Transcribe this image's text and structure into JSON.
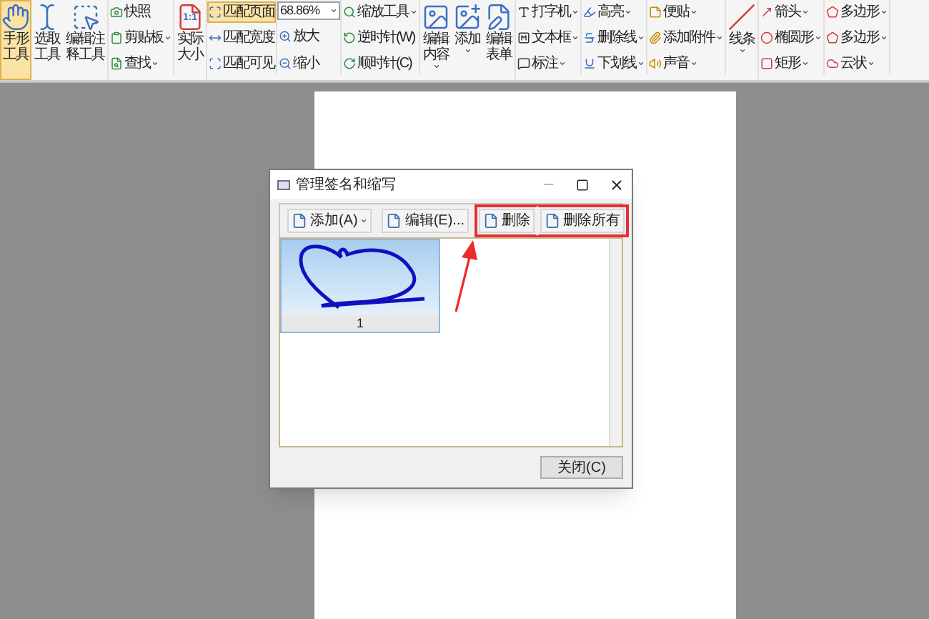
{
  "toolbar": {
    "sections": [
      {
        "kind": "big",
        "items": [
          {
            "label": "手形工具",
            "selected": true,
            "dropdown": false
          },
          {
            "label": "选取工具",
            "selected": false,
            "dropdown": false
          },
          {
            "label": "编辑注释工具",
            "selected": false,
            "dropdown": false
          }
        ]
      },
      {
        "kind": "stack",
        "items": [
          {
            "label": "快照",
            "selected": false,
            "dropdown": false
          },
          {
            "label": "剪贴板",
            "selected": false,
            "dropdown": true
          },
          {
            "label": "查找",
            "selected": false,
            "dropdown": true
          }
        ]
      },
      {
        "kind": "big",
        "items": [
          {
            "label": "实际大小",
            "badge": "1:1",
            "selected": false,
            "dropdown": false
          }
        ]
      },
      {
        "kind": "stack",
        "items": [
          {
            "label": "匹配页面",
            "selected": true,
            "dropdown": false
          },
          {
            "label": "匹配宽度",
            "selected": false,
            "dropdown": false
          },
          {
            "label": "匹配可见",
            "selected": false,
            "dropdown": false
          }
        ]
      },
      {
        "kind": "zoom",
        "items": [
          {
            "label": "68.86%",
            "dropdown": true
          },
          {
            "label": "放大",
            "selected": false,
            "dropdown": false
          },
          {
            "label": "缩小",
            "selected": false,
            "dropdown": false
          }
        ]
      },
      {
        "kind": "stack",
        "items": [
          {
            "label": "缩放工具",
            "selected": false,
            "dropdown": true
          },
          {
            "label": "逆时针(W)",
            "selected": false,
            "dropdown": false
          },
          {
            "label": "顺时针(C)",
            "selected": false,
            "dropdown": false
          }
        ]
      },
      {
        "kind": "big",
        "items": [
          {
            "label": "编辑内容",
            "selected": false,
            "dropdown": true
          },
          {
            "label": "添加",
            "selected": false,
            "dropdown": true
          },
          {
            "label": "编辑表单",
            "selected": false,
            "dropdown": false
          }
        ]
      },
      {
        "kind": "stack",
        "items": [
          {
            "label": "打字机",
            "selected": false,
            "dropdown": true
          },
          {
            "label": "文本框",
            "selected": false,
            "dropdown": true
          },
          {
            "label": "标注",
            "selected": false,
            "dropdown": true
          }
        ]
      },
      {
        "kind": "stack",
        "items": [
          {
            "label": "高亮",
            "selected": false,
            "dropdown": true
          },
          {
            "label": "删除线",
            "selected": false,
            "dropdown": true
          },
          {
            "label": "下划线",
            "selected": false,
            "dropdown": true
          }
        ]
      },
      {
        "kind": "stack",
        "items": [
          {
            "label": "便贴",
            "selected": false,
            "dropdown": true
          },
          {
            "label": "添加附件",
            "selected": false,
            "dropdown": true
          },
          {
            "label": "声音",
            "selected": false,
            "dropdown": true
          }
        ]
      },
      {
        "kind": "big",
        "items": [
          {
            "label": "线条",
            "selected": false,
            "dropdown": true
          }
        ]
      },
      {
        "kind": "stack",
        "items": [
          {
            "label": "箭头",
            "selected": false,
            "dropdown": true
          },
          {
            "label": "椭圆形",
            "selected": false,
            "dropdown": true
          },
          {
            "label": "矩形",
            "selected": false,
            "dropdown": true
          }
        ]
      },
      {
        "kind": "stack",
        "items": [
          {
            "label": "多边形",
            "selected": false,
            "dropdown": true
          },
          {
            "label": "多边形",
            "selected": false,
            "dropdown": true
          },
          {
            "label": "云状",
            "selected": false,
            "dropdown": true
          }
        ]
      }
    ]
  },
  "dialog": {
    "title": "管理签名和缩写",
    "buttons": [
      {
        "label": "添加(A)",
        "dropdown": true,
        "annotated": false
      },
      {
        "label": "编辑(E)...",
        "dropdown": false,
        "annotated": false
      },
      {
        "label": "删除",
        "dropdown": false,
        "annotated": true
      },
      {
        "label": "删除所有",
        "dropdown": false,
        "annotated": true
      }
    ],
    "signatures": [
      {
        "label": "1",
        "selected": true
      }
    ],
    "close_button": "关闭(C)"
  }
}
